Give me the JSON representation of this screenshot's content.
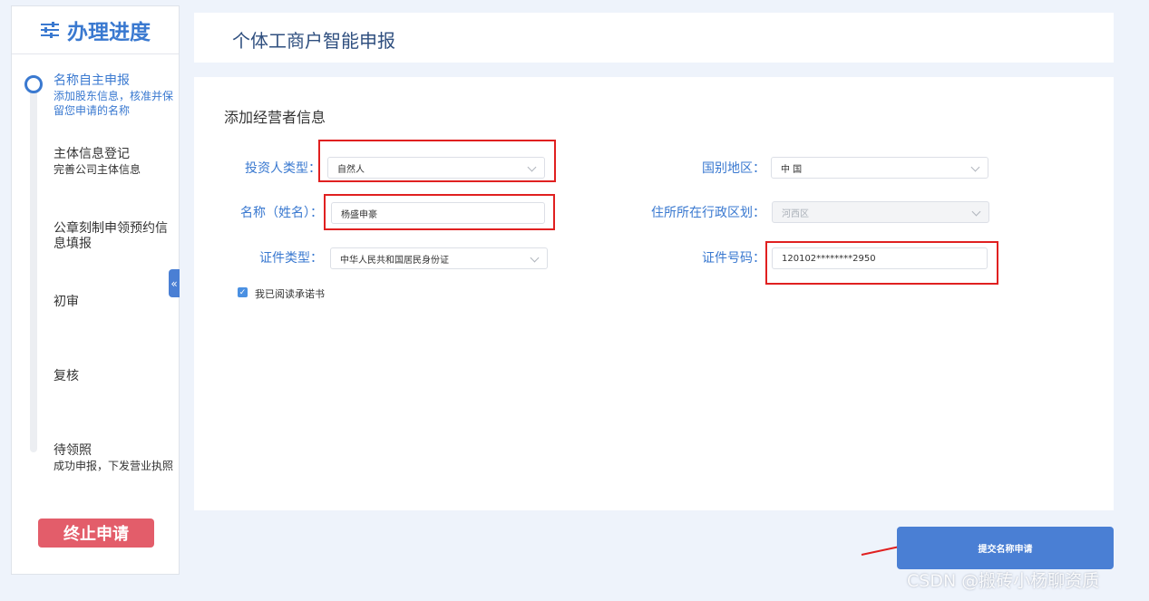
{
  "sidebar": {
    "title": "办理进度",
    "steps": [
      {
        "title": "名称自主申报",
        "desc": "添加股东信息，核准并保留您申请的名称"
      },
      {
        "title": "主体信息登记",
        "desc": "完善公司主体信息"
      },
      {
        "title": "公章刻制申领预约信息填报",
        "desc": ""
      },
      {
        "title": "初审",
        "desc": ""
      },
      {
        "title": "复核",
        "desc": ""
      },
      {
        "title": "待领照",
        "desc": "成功申报，下发营业执照"
      }
    ],
    "stop_label": "终止申请",
    "collapse_icon": "«"
  },
  "header": {
    "title": "个体工商户智能申报"
  },
  "form": {
    "section_title": "添加经营者信息",
    "investor_type": {
      "label": "投资人类型：",
      "value": "自然人"
    },
    "country": {
      "label": "国别地区：",
      "value": "中 国"
    },
    "name": {
      "label": "名称（姓名）：",
      "value": "杨盛申豪"
    },
    "district": {
      "label": "住所所在行政区划：",
      "value": "河西区"
    },
    "id_type": {
      "label": "证件类型：",
      "value": "中华人民共和国居民身份证"
    },
    "id_number": {
      "label": "证件号码：",
      "value": "120102********2950"
    },
    "agree_label": "我已阅读承诺书",
    "agree_checked": true
  },
  "submit_label": "提交名称申请",
  "watermark": "CSDN @搬砖小杨聊资质",
  "colors": {
    "accent": "#3a79d0",
    "danger": "#e35d6a",
    "highlight": "#e02020"
  }
}
